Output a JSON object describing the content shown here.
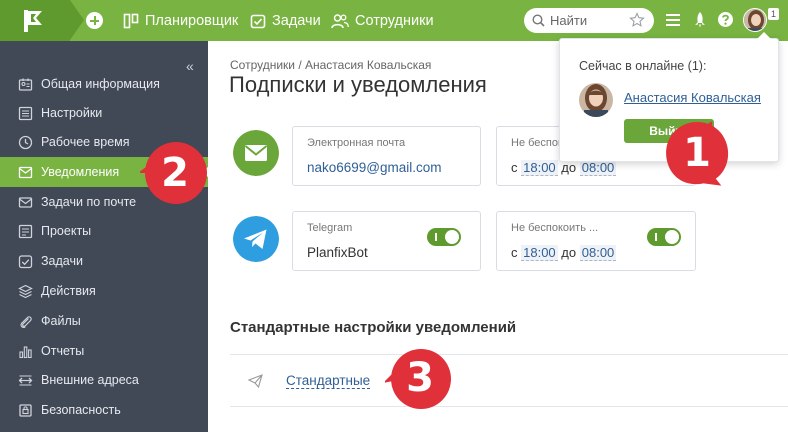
{
  "topbar": {
    "nav": [
      {
        "label": "Планировщик",
        "icon": "planner-icon"
      },
      {
        "label": "Задачи",
        "icon": "tasks-icon"
      },
      {
        "label": "Сотрудники",
        "icon": "people-icon"
      }
    ],
    "search_placeholder": "Найти",
    "notification_count": "1",
    "brand_color": "#79b442"
  },
  "sidebar": {
    "items": [
      {
        "label": "Общая информация",
        "icon": "info-icon"
      },
      {
        "label": "Настройки",
        "icon": "settings-icon"
      },
      {
        "label": "Рабочее время",
        "icon": "clock-icon"
      },
      {
        "label": "Уведомления",
        "icon": "notifications-icon",
        "active": true
      },
      {
        "label": "Задачи по почте",
        "icon": "mail-tasks-icon"
      },
      {
        "label": "Проекты",
        "icon": "projects-icon"
      },
      {
        "label": "Задачи",
        "icon": "tasks-icon"
      },
      {
        "label": "Действия",
        "icon": "actions-icon"
      },
      {
        "label": "Файлы",
        "icon": "files-icon"
      },
      {
        "label": "Отчеты",
        "icon": "reports-icon"
      },
      {
        "label": "Внешние адреса",
        "icon": "external-icon"
      },
      {
        "label": "Безопасность",
        "icon": "security-icon"
      }
    ]
  },
  "main": {
    "breadcrumb": "Сотрудники / Анастасия Ковальская",
    "title": "Подписки и уведомления",
    "email": {
      "label": "Электронная почта",
      "value": "nako6699@gmail.com",
      "dnd_label": "Не беспокоить ...",
      "from_prefix": "с",
      "from": "18:00",
      "to_prefix": "до",
      "to": "08:00"
    },
    "telegram": {
      "label": "Telegram",
      "value": "PlanfixBot",
      "dnd_label": "Не беспокоить ...",
      "from_prefix": "с",
      "from": "18:00",
      "to_prefix": "до",
      "to": "08:00"
    },
    "section_title": "Стандартные настройки уведомлений",
    "standard_link": "Стандартные"
  },
  "popup": {
    "title": "Сейчас в онлайне (1):",
    "user": "Анастасия Ковальская",
    "logout": "Выйти"
  },
  "markers": [
    "1",
    "2",
    "3"
  ],
  "marker_color": "#e0303a"
}
